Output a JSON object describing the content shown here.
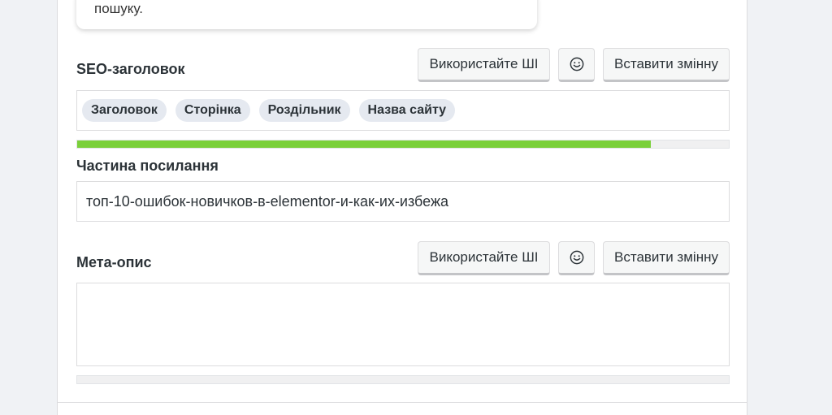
{
  "tooltip": {
    "text": "пошуку."
  },
  "seo_title": {
    "label": "SEO-заголовок",
    "ai_button": "Використайте ШІ",
    "emoji_icon": "smile-icon",
    "insert_variable_button": "Вставити змінну",
    "tags": [
      "Заголовок",
      "Сторінка",
      "Роздільник",
      "Назва сайту"
    ],
    "progress_fraction": 0.88,
    "progress_color": "#7ad03a"
  },
  "slug": {
    "label": "Частина посилання",
    "value": "топ-10-ошибок-новичков-в-elementor-и-как-их-избежа"
  },
  "meta_description": {
    "label": "Мета-опис",
    "ai_button": "Використайте ШІ",
    "emoji_icon": "smile-icon",
    "insert_variable_button": "Вставити змінну",
    "value": "",
    "progress_fraction": 0
  }
}
